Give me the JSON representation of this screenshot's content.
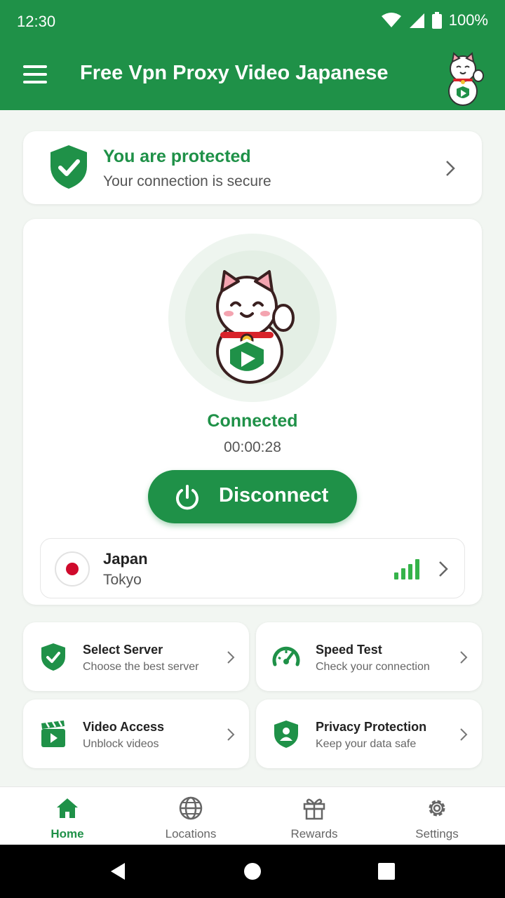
{
  "status": {
    "time": "12:30",
    "battery": "100%"
  },
  "app": {
    "title": "Free Vpn Proxy Video Japanese"
  },
  "protection": {
    "title": "You are protected",
    "subtitle": "Your connection is secure"
  },
  "connection": {
    "status": "Connected",
    "timer": "00:00:28",
    "button_label": "Disconnect",
    "location": {
      "country": "Japan",
      "city": "Tokyo",
      "signal_bars": 4
    }
  },
  "tiles": [
    {
      "title": "Select Server",
      "subtitle": "Choose the best server",
      "icon": "shield-check-icon"
    },
    {
      "title": "Speed Test",
      "subtitle": "Check your connection",
      "icon": "speedometer-icon"
    },
    {
      "title": "Video Access",
      "subtitle": "Unblock videos",
      "icon": "clapperboard-icon"
    },
    {
      "title": "Privacy Protection",
      "subtitle": "Keep your data safe",
      "icon": "shield-user-icon"
    }
  ],
  "nav": [
    {
      "label": "Home",
      "icon": "home-icon",
      "active": true
    },
    {
      "label": "Locations",
      "icon": "globe-icon",
      "active": false
    },
    {
      "label": "Rewards",
      "icon": "gift-icon",
      "active": false
    },
    {
      "label": "Settings",
      "icon": "gear-icon",
      "active": false
    }
  ],
  "colors": {
    "primary": "#1f9148",
    "signal": "#35b34a",
    "flag_red": "#cf0a2c"
  }
}
